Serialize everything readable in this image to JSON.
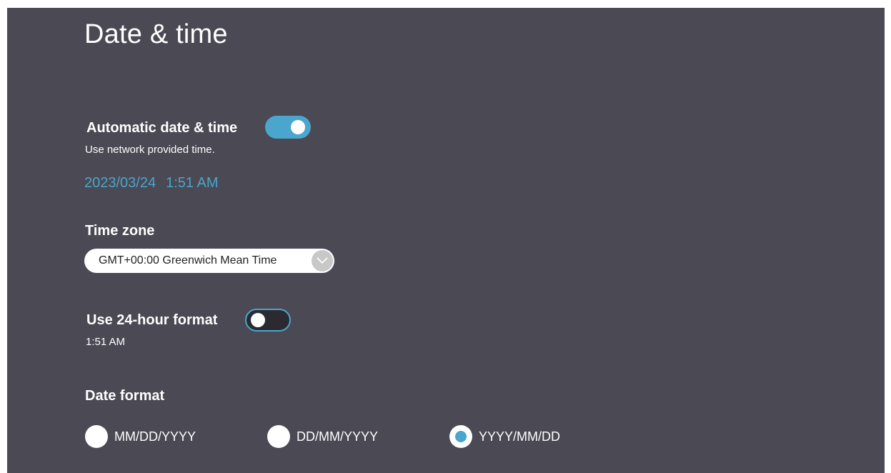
{
  "page": {
    "title": "Date & time"
  },
  "automatic_datetime": {
    "label": "Automatic date & time",
    "description": "Use network provided time.",
    "enabled": true,
    "current_date": "2023/03/24",
    "current_time": "1:51 AM"
  },
  "time_zone": {
    "label": "Time zone",
    "selected": "GMT+00:00 Greenwich Mean Time",
    "icon": "chevron-down-icon"
  },
  "hour_format": {
    "label": "Use 24-hour format",
    "enabled": false,
    "preview": "1:51 AM"
  },
  "date_format": {
    "label": "Date format",
    "options": [
      {
        "label": "MM/DD/YYYY",
        "selected": false
      },
      {
        "label": "DD/MM/YYYY",
        "selected": false
      },
      {
        "label": "YYYY/MM/DD",
        "selected": true
      }
    ]
  },
  "colors": {
    "background": "#4a4954",
    "accent": "#4aa6cc",
    "text": "#ffffff"
  }
}
